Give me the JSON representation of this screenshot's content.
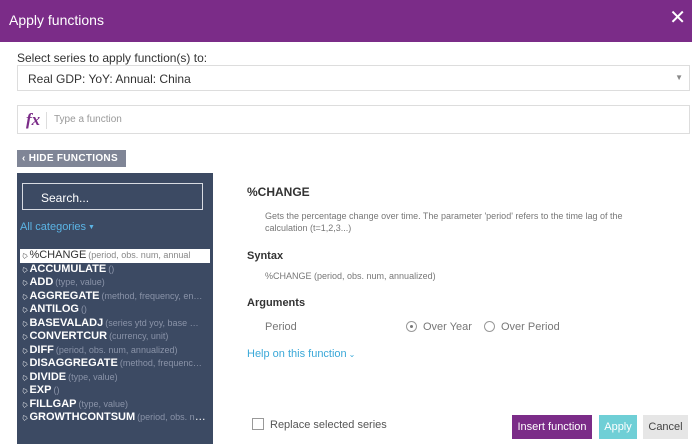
{
  "dialog": {
    "title": "Apply functions",
    "close_symbol": "✕"
  },
  "series": {
    "label": "Select series to apply function(s) to:",
    "selected": "Real GDP: YoY: Annual: China"
  },
  "function_input": {
    "icon": "fx",
    "placeholder": "Type a function"
  },
  "toggle_functions": "‹ HIDE FUNCTIONS",
  "sidebar": {
    "search_placeholder": "Search...",
    "categories_label": "All categories",
    "functions": [
      {
        "name": "%CHANGE",
        "params": "(period, obs. num, annual",
        "selected": true
      },
      {
        "name": "ACCUMULATE",
        "params": "()"
      },
      {
        "name": "ADD",
        "params": "(type, value)"
      },
      {
        "name": "AGGREGATE",
        "params": "(method, frequency, en…"
      },
      {
        "name": "ANTILOG",
        "params": "()"
      },
      {
        "name": "BASEVALADJ",
        "params": "(series ytd yoy, base …"
      },
      {
        "name": "CONVERTCUR",
        "params": "(currency, unit)"
      },
      {
        "name": "DIFF",
        "params": "(period, obs. num, annualized)"
      },
      {
        "name": "DISAGGREGATE",
        "params": "(method, frequenc…"
      },
      {
        "name": "DIVIDE",
        "params": "(type, value)"
      },
      {
        "name": "EXP",
        "params": "()"
      },
      {
        "name": "FILLGAP",
        "params": "(type, value)"
      },
      {
        "name": "GROWTHCONTSUM",
        "params": "(period, obs. num…"
      }
    ]
  },
  "detail": {
    "name": "%CHANGE",
    "description": "Gets the percentage change over time. The parameter 'period' refers to the time lag of the calculation (t=1,2,3...)",
    "syntax_heading": "Syntax",
    "syntax": "%CHANGE (period, obs. num, annualized)",
    "arguments_heading": "Arguments",
    "argument_name": "Period",
    "options": [
      {
        "label": "Over Year",
        "checked": true
      },
      {
        "label": "Over Period",
        "checked": false
      }
    ],
    "help_link": "Help on this function"
  },
  "footer": {
    "replace_label": "Replace selected series",
    "insert_label": "Insert function",
    "apply_label": "Apply",
    "cancel_label": "Cancel"
  },
  "colors": {
    "accent": "#7b2c88",
    "sidebar": "#3c4a63",
    "apply": "#6fcfd6",
    "link": "#3aa8d8"
  }
}
